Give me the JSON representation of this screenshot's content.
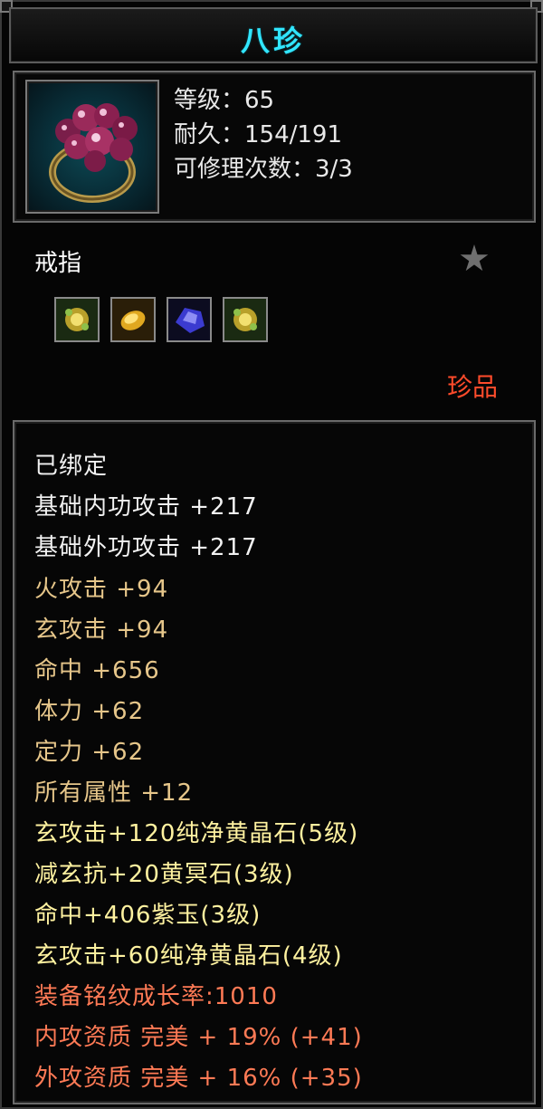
{
  "item": {
    "name": "八珍",
    "level_line": "等级：65",
    "durability_line": "耐久：154/191",
    "repair_line": "可修理次数：3/3",
    "type": "戒指",
    "rarity": "珍品"
  },
  "gems": [
    {
      "icon": "yellow-flower-gem-icon"
    },
    {
      "icon": "gold-leaf-gem-icon"
    },
    {
      "icon": "purple-jade-gem-icon"
    },
    {
      "icon": "yellow-flower-gem-icon"
    }
  ],
  "attributes": [
    {
      "text": "已绑定",
      "color": "white"
    },
    {
      "text": "基础内功攻击  +217",
      "color": "white"
    },
    {
      "text": "基础外功攻击  +217",
      "color": "white"
    },
    {
      "text": "火攻击  +94",
      "color": "gold"
    },
    {
      "text": "玄攻击  +94",
      "color": "gold"
    },
    {
      "text": "命中  +656",
      "color": "gold"
    },
    {
      "text": "体力  +62",
      "color": "gold"
    },
    {
      "text": "定力  +62",
      "color": "gold"
    },
    {
      "text": "所有属性  +12",
      "color": "gold"
    },
    {
      "text": "玄攻击+120纯净黄晶石(5级)",
      "color": "yellow"
    },
    {
      "text": "减玄抗+20黄冥石(3级)",
      "color": "yellow"
    },
    {
      "text": "命中+406紫玉(3级)",
      "color": "yellow"
    },
    {
      "text": "玄攻击+60纯净黄晶石(4级)",
      "color": "yellow"
    },
    {
      "text": "装备铭纹成长率:1010",
      "color": "orange"
    },
    {
      "text": "内攻资质  完美  + 19% (+41)",
      "color": "orange"
    },
    {
      "text": "外攻资质  完美  + 16% (+35)",
      "color": "orange"
    }
  ],
  "colors": {
    "title": "#31e6ff",
    "white": "#f2f2f2",
    "gold": "#e6c68a",
    "yellow": "#fff2a0",
    "orange": "#ff7a55",
    "rarity": "#ff4b2b"
  }
}
